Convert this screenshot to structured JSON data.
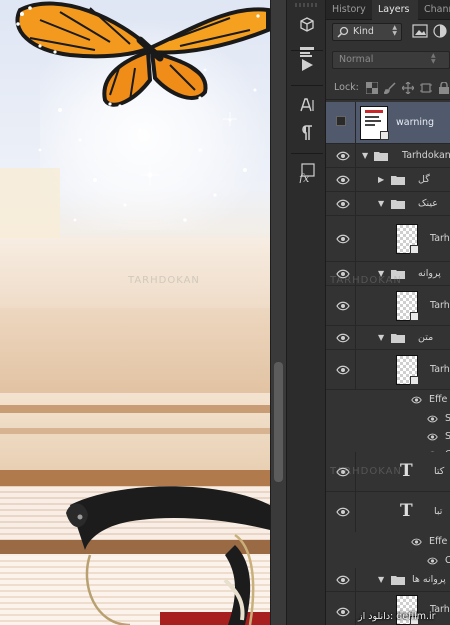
{
  "tabs": {
    "history": "History",
    "layers": "Layers",
    "channels": "Channe"
  },
  "filter": {
    "kind_label": "Kind"
  },
  "blend": {
    "mode": "Normal"
  },
  "lock": {
    "label": "Lock:"
  },
  "layers": [
    {
      "name": "warning",
      "type": "smart-object",
      "selected": true
    },
    {
      "name": "Tarhdokan",
      "type": "group",
      "expanded": true
    },
    {
      "name": "گل",
      "type": "group",
      "expanded": false
    },
    {
      "name": "عینک",
      "type": "group",
      "expanded": true
    },
    {
      "name": "Tarh",
      "type": "smart-object"
    },
    {
      "name": "پروانه",
      "type": "group",
      "expanded": true
    },
    {
      "name": "Tarh",
      "type": "smart-object"
    },
    {
      "name": "متن",
      "type": "group",
      "expanded": true
    },
    {
      "name": "Tarh",
      "type": "smart-object"
    },
    {
      "name": "Effe",
      "type": "effects"
    },
    {
      "name": "S",
      "type": "effect"
    },
    {
      "name": "S",
      "type": "effect"
    },
    {
      "name": "C",
      "type": "effect"
    },
    {
      "name": "کتا",
      "type": "text"
    },
    {
      "name": "تبا",
      "type": "text"
    },
    {
      "name": "Effe",
      "type": "effects"
    },
    {
      "name": "C",
      "type": "effect"
    },
    {
      "name": "پروانه ها",
      "type": "group",
      "expanded": true
    },
    {
      "name": "Tarh",
      "type": "smart-object"
    }
  ],
  "watermark": "TARHDOKAN",
  "credit": "دانلود از: defilm.ir"
}
